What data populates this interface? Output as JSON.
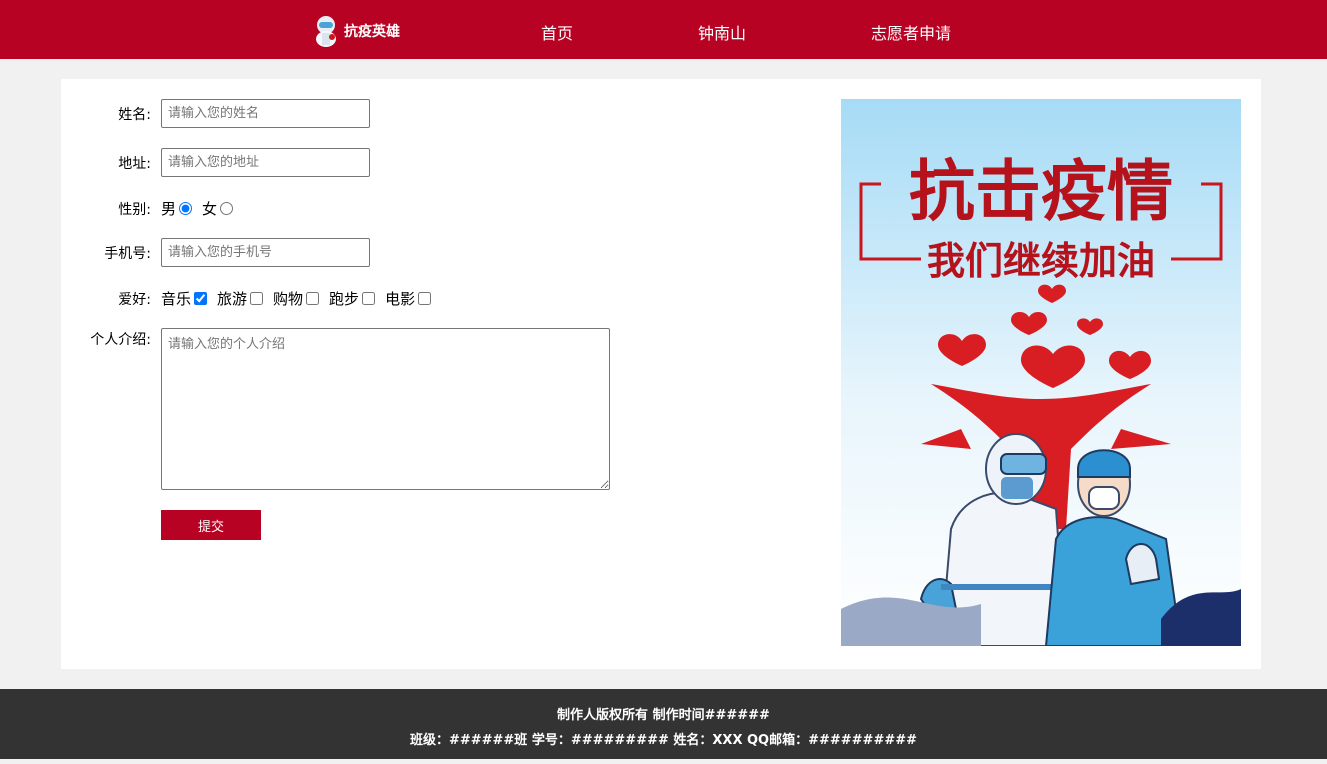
{
  "header": {
    "brand": "抗疫英雄",
    "nav": [
      {
        "label": "首页"
      },
      {
        "label": "钟南山"
      },
      {
        "label": "志愿者申请"
      }
    ]
  },
  "form": {
    "name": {
      "label": "姓名:",
      "placeholder": "请输入您的姓名",
      "value": ""
    },
    "address": {
      "label": "地址:",
      "placeholder": "请输入您的地址",
      "value": ""
    },
    "gender": {
      "label": "性别:",
      "options": [
        {
          "label": "男",
          "checked": true
        },
        {
          "label": "女",
          "checked": false
        }
      ]
    },
    "phone": {
      "label": "手机号:",
      "placeholder": "请输入您的手机号",
      "value": ""
    },
    "hobbies": {
      "label": "爱好:",
      "options": [
        {
          "label": "音乐",
          "checked": true
        },
        {
          "label": "旅游",
          "checked": false
        },
        {
          "label": "购物",
          "checked": false
        },
        {
          "label": "跑步",
          "checked": false
        },
        {
          "label": "电影",
          "checked": false
        }
      ]
    },
    "intro": {
      "label": "个人介绍:",
      "placeholder": "请输入您的个人介绍",
      "value": ""
    },
    "submit_label": "提交"
  },
  "poster": {
    "title": "抗击疫情",
    "subtitle": "我们继续加油",
    "colors": {
      "sky": "#a9dcf5",
      "red": "#c8161d",
      "blue": "#2b8fd0"
    }
  },
  "footer": {
    "line1": "制作人版权所有 制作时间######",
    "line2": "班级：######班 学号：######### 姓名：XXX QQ邮箱：##########"
  },
  "colors": {
    "brand_red": "#b80223",
    "footer_bg": "#333333",
    "page_bg": "#f1f1f1"
  }
}
